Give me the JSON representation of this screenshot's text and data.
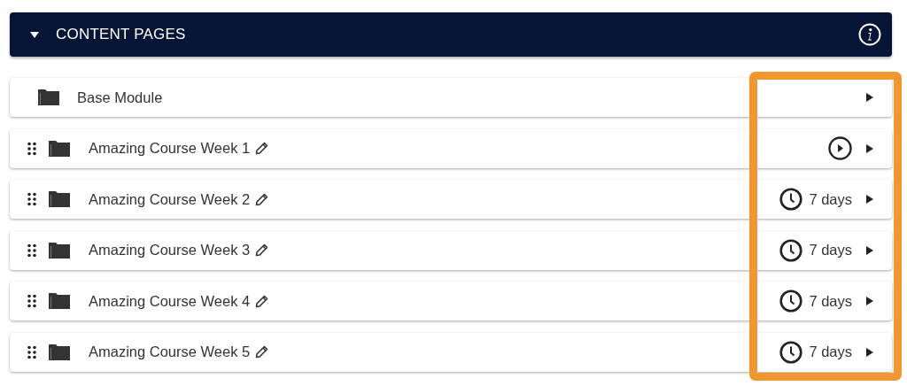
{
  "section": {
    "title": "CONTENT PAGES",
    "expanded": true
  },
  "rows": [
    {
      "label": "Base Module",
      "draggable": false,
      "editable": false
    },
    {
      "label": "Amazing Course Week 1",
      "draggable": true,
      "editable": true,
      "status": {
        "kind": "play"
      }
    },
    {
      "label": "Amazing Course Week 2",
      "draggable": true,
      "editable": true,
      "status": {
        "kind": "timer",
        "text": "7 days"
      }
    },
    {
      "label": "Amazing Course Week 3",
      "draggable": true,
      "editable": true,
      "status": {
        "kind": "timer",
        "text": "7 days"
      }
    },
    {
      "label": "Amazing Course Week 4",
      "draggable": true,
      "editable": true,
      "status": {
        "kind": "timer",
        "text": "7 days"
      }
    },
    {
      "label": "Amazing Course Week 5",
      "draggable": true,
      "editable": true,
      "status": {
        "kind": "timer",
        "text": "7 days"
      }
    }
  ],
  "highlight": {
    "kind": "outline"
  }
}
